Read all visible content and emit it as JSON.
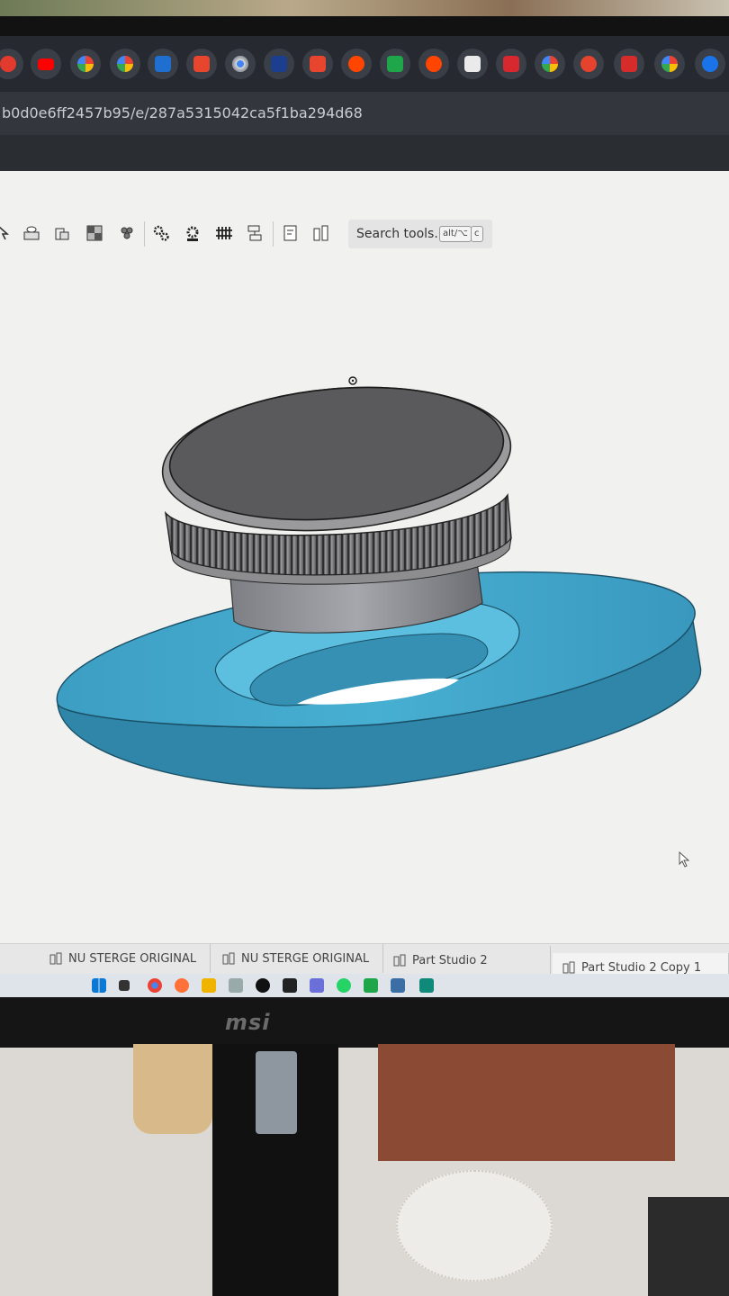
{
  "browser": {
    "url": "b0d0e6ff2457b95/e/287a5315042ca5f1ba294d68",
    "tab_favicons": [
      "red-app-icon",
      "youtube-icon",
      "google-icon",
      "google-icon",
      "blue-app-icon",
      "red-doc-icon",
      "chrome-icon",
      "paypal-icon",
      "red-doc-icon",
      "reddit-icon",
      "green-app-icon",
      "reddit-icon",
      "dark-app-icon",
      "red-app-icon",
      "google-icon",
      "red-star-icon",
      "red-app-icon",
      "google-icon",
      "blue-gear-icon"
    ]
  },
  "toolbar": {
    "search_label": "Search tools...",
    "shortcut_key_1": "alt/⌥",
    "shortcut_key_2": "c"
  },
  "doc_tabs": [
    {
      "label": "NU STERGE ORIGINAL"
    },
    {
      "label": "NU STERGE ORIGINAL"
    },
    {
      "label": "Part Studio 2"
    },
    {
      "label": "Part Studio 2 Copy 1"
    }
  ],
  "monitor": {
    "brand": "msi"
  },
  "colors": {
    "part_blue": "#3fa7c9",
    "knob_gray": "#5a5a5c",
    "viewport_bg": "#f1f1ef"
  }
}
